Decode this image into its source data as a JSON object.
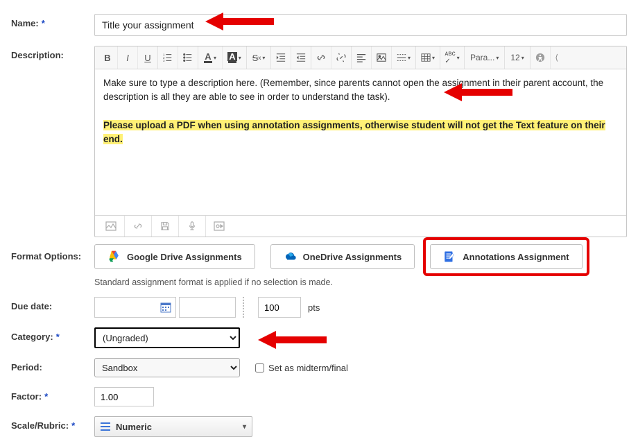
{
  "name": {
    "label": "Name:",
    "value": "Title your assignment"
  },
  "description": {
    "label": "Description:",
    "body_p1": "Make sure to type a description here. (Remember, since parents cannot open the assignment in their parent account, the description is all they are able to see in order to understand the task).",
    "body_hl": "Please upload a PDF when using annotation assignments, otherwise student will not get the Text feature on their end.",
    "toolbar": {
      "para": "Para...",
      "size": "12"
    }
  },
  "format": {
    "label": "Format Options:",
    "google": "Google Drive Assignments",
    "onedrive": "OneDrive Assignments",
    "annotations": "Annotations Assignment",
    "hint": "Standard assignment format is applied if no selection is made."
  },
  "due": {
    "label": "Due date:",
    "points_value": "100",
    "points_label": "pts"
  },
  "category": {
    "label": "Category:",
    "value": "(Ungraded)"
  },
  "period": {
    "label": "Period:",
    "value": "Sandbox",
    "midterm_label": "Set as midterm/final"
  },
  "factor": {
    "label": "Factor:",
    "value": "1.00"
  },
  "scale": {
    "label": "Scale/Rubric:",
    "value": "Numeric"
  }
}
